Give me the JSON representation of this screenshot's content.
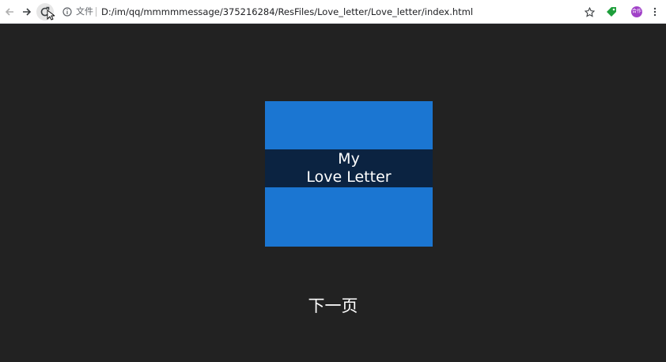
{
  "browser": {
    "security_label": "文件",
    "url": "D:/im/qq/mmmmmessage/375216284/ResFiles/Love_letter/Love_letter/index.html",
    "avatar_text": "合作"
  },
  "icons": {
    "back": "arrow-left-icon",
    "forward": "arrow-right-icon",
    "reload": "reload-icon",
    "info": "info-icon",
    "bookmark": "star-icon",
    "extension": "tag-icon",
    "menu": "more-vertical-icon"
  },
  "colors": {
    "page_background": "#222222",
    "cover": "#1b76d2",
    "cover_band": "#0b2341",
    "extension": "#1e9e3b",
    "avatar": "#a142c8"
  },
  "cover": {
    "line1": "My",
    "line2": "Love Letter"
  },
  "next_page": "下一页"
}
